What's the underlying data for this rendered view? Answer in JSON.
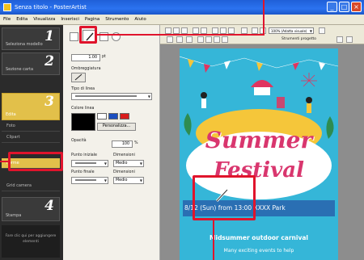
{
  "window": {
    "title": "Senza titolo - PosterArtist",
    "buttons": [
      "_",
      "□",
      "×"
    ]
  },
  "menu": [
    "File",
    "Edita",
    "Visualizza",
    "Inserisci",
    "Pagina",
    "Strumento",
    "Aiuto"
  ],
  "steps": [
    {
      "num": "1",
      "label": "Seleziona modello"
    },
    {
      "num": "2",
      "label": "Sezione carta"
    },
    {
      "num": "3",
      "label": "Edita"
    },
    {
      "num": "4",
      "label": "Stampa"
    }
  ],
  "substeps": [
    "Foto",
    "Clipart",
    "Forme",
    "Grid camera"
  ],
  "help_text": "Fare clic qui per aggiungere elementi",
  "panel": {
    "spessore_value": "1.00",
    "spessore_unit": "pt",
    "ombreggiatura_label": "Ombreggiatura",
    "tipo_linea_label": "Tipo di linea",
    "colore_linea_label": "Colore linea",
    "personalizza_label": "Personalizza...",
    "opacita_label": "Opacità",
    "opacita_value": "100",
    "opacita_unit": "%",
    "punto_iniziale_label": "Punto iniziale",
    "punto_finale_label": "Punto finale",
    "dimensioni_label": "Dimensioni",
    "dimensioni_value": "Medio",
    "colors": [
      "#000000",
      "#ffffff",
      "#1b4fc0",
      "#d81c1c"
    ]
  },
  "toolbar": {
    "zoom_value": "100% (Adatta visuale)",
    "strumenti_label": "Strumenti progetto"
  },
  "poster": {
    "title_line1": "Summer",
    "title_line2": "Festival",
    "date_text": "8/12 (Sun) from 13:00  XXXX Park",
    "subtitle": "Midsummer outdoor carnival",
    "body": "Many exciting events to help",
    "colors": {
      "bg": "#35b6d8",
      "title": "#d9366e",
      "banner": "#2a6fb3"
    }
  }
}
